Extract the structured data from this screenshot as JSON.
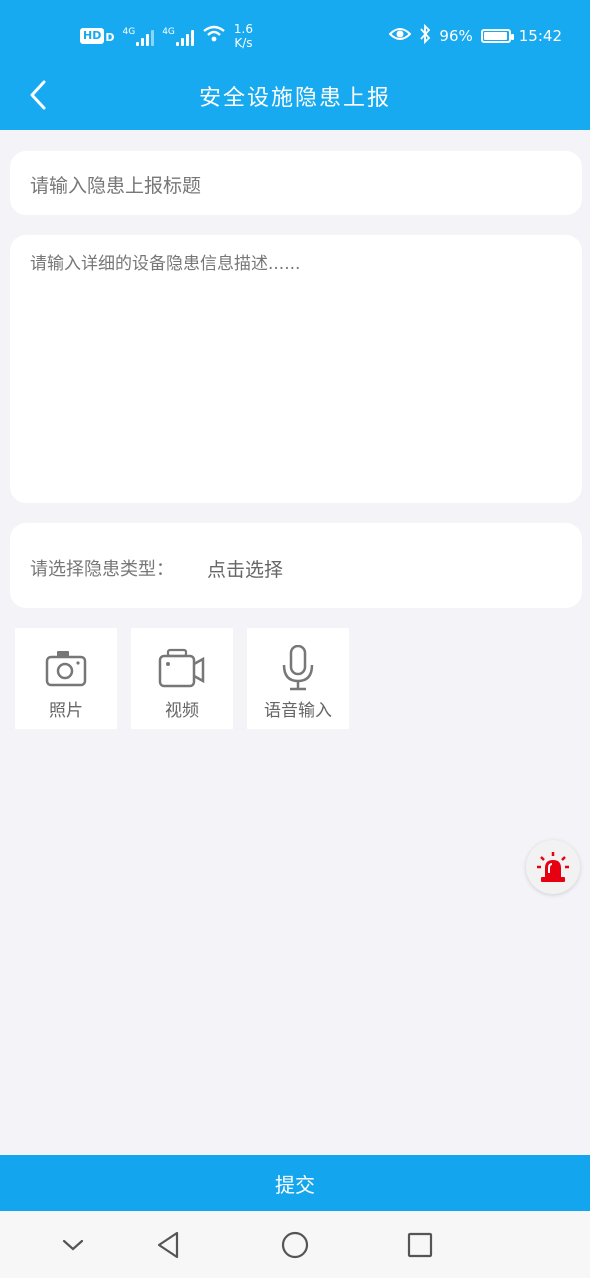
{
  "status_bar": {
    "hd_label": "HD",
    "hd_sub": "D",
    "net1": "4G",
    "net2": "4G",
    "speed_value": "1.6",
    "speed_unit": "K/s",
    "battery_percent": "96%",
    "battery_level": 0.96,
    "time": "15:42"
  },
  "header": {
    "title": "安全设施隐患上报",
    "back_icon": "chevron-left-icon",
    "color": "#17aaf0"
  },
  "form": {
    "title_placeholder": "请输入隐患上报标题",
    "description_placeholder": "请输入详细的设备隐患信息描述......",
    "type_label": "请选择隐患类型：",
    "type_value": "点击选择"
  },
  "media": [
    {
      "label": "照片",
      "icon": "camera-icon"
    },
    {
      "label": "视频",
      "icon": "video-camera-icon"
    },
    {
      "label": "语音输入",
      "icon": "microphone-icon"
    }
  ],
  "floating": {
    "icon": "alarm-siren-icon",
    "color": "#e60012"
  },
  "submit": {
    "label": "提交",
    "color": "#13a6ee"
  },
  "system_nav": [
    "chevron-down-icon",
    "back-triangle-icon",
    "home-circle-icon",
    "recents-square-icon"
  ]
}
